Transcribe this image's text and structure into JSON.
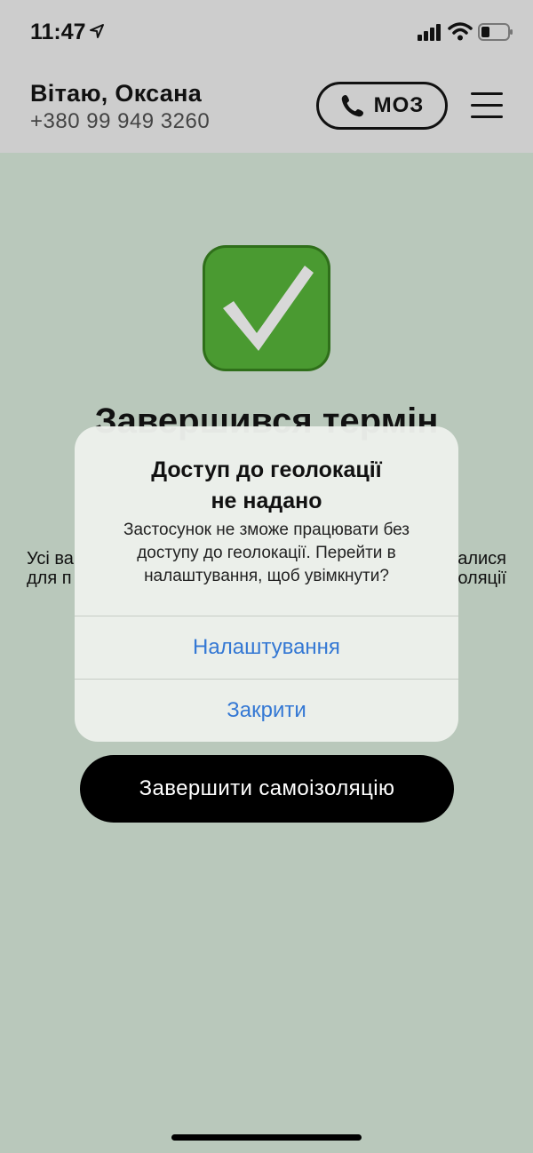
{
  "status_bar": {
    "time": "11:47"
  },
  "header": {
    "greeting": "Вітаю, Оксана",
    "phone": "+380 99 949 3260",
    "moz_label": "МОЗ"
  },
  "main": {
    "title": "Завершився термін",
    "desc_left": [
      "Усі ва",
      "для п"
    ],
    "desc_right": [
      "алися",
      "оляції"
    ],
    "end_button_label": "Завершити самоізоляцію"
  },
  "alert": {
    "title_line1": "Доступ до геолокації",
    "title_line2": "не надано",
    "message_line1": "Застосунок не зможе працювати без",
    "message_line2": "доступу до геолокації. Перейти в",
    "message_line3": "налаштування, щоб увімкнути?",
    "settings_label": "Налаштування",
    "close_label": "Закрити"
  },
  "colors": {
    "background": "#b9c8bb",
    "header": "#cdcdcd",
    "accent_blue": "#3478d4",
    "check_green": "#3f8f27"
  },
  "icons": [
    "location-arrow-icon",
    "cellular-signal-icon",
    "wifi-icon",
    "battery-icon",
    "phone-icon",
    "menu-icon",
    "checkmark-icon"
  ]
}
